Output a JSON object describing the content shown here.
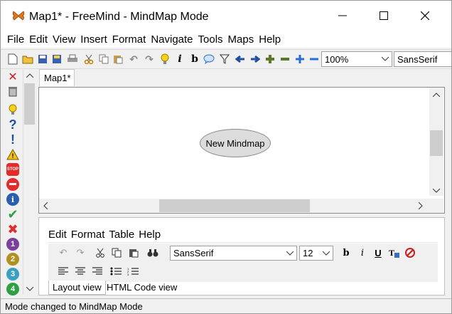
{
  "window": {
    "title": "Map1* - FreeMind - MindMap Mode",
    "icon": "butterfly-icon"
  },
  "menubar": [
    "File",
    "Edit",
    "View",
    "Insert",
    "Format",
    "Navigate",
    "Tools",
    "Maps",
    "Help"
  ],
  "toolbar": {
    "zoom": "100%",
    "font": "SansSerif"
  },
  "map_tab": "Map1*",
  "node": {
    "label": "New Mindmap"
  },
  "editor": {
    "menu": [
      "Edit",
      "Format",
      "Table",
      "Help"
    ],
    "font": "SansSerif",
    "size": "12",
    "tabs": [
      "Layout view",
      "HTML Code view"
    ]
  },
  "status": "Mode changed to MindMap Mode",
  "colors": {
    "node_fill": "#dcdcdc",
    "red": "#e32b2b",
    "green": "#2ea043",
    "blue": "#2a5db0"
  }
}
